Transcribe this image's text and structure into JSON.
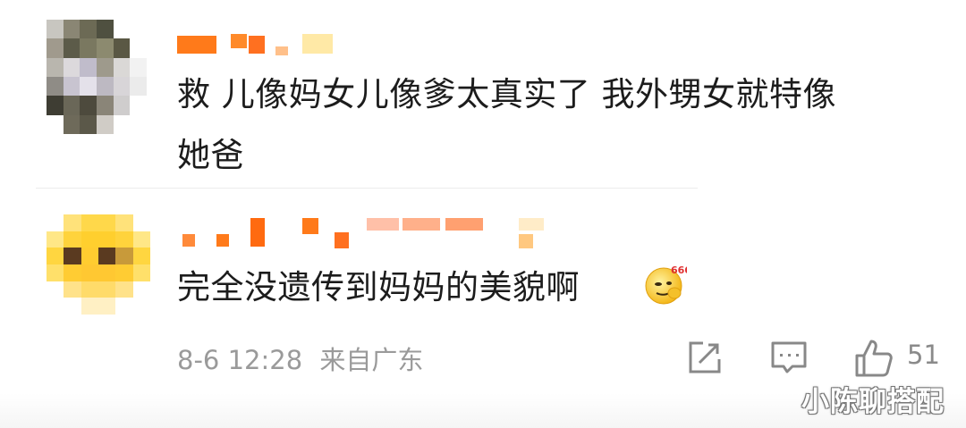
{
  "comments": [
    {
      "username": "",
      "lines": [
        "救 儿像妈女儿像爹太真实了 我外甥女就特像",
        "她爸"
      ]
    },
    {
      "username": "",
      "lines": [
        "完全没遗传到妈妈的美貌啊"
      ],
      "emoji": "666-emoji-icon",
      "timestamp": "8-6 12:28",
      "location": "来自广东",
      "like_count": "51"
    }
  ],
  "watermark": "小陈聊搭配",
  "colors": {
    "accent_orange": "#ff7a1a",
    "meta_gray": "#9a9a9a"
  }
}
